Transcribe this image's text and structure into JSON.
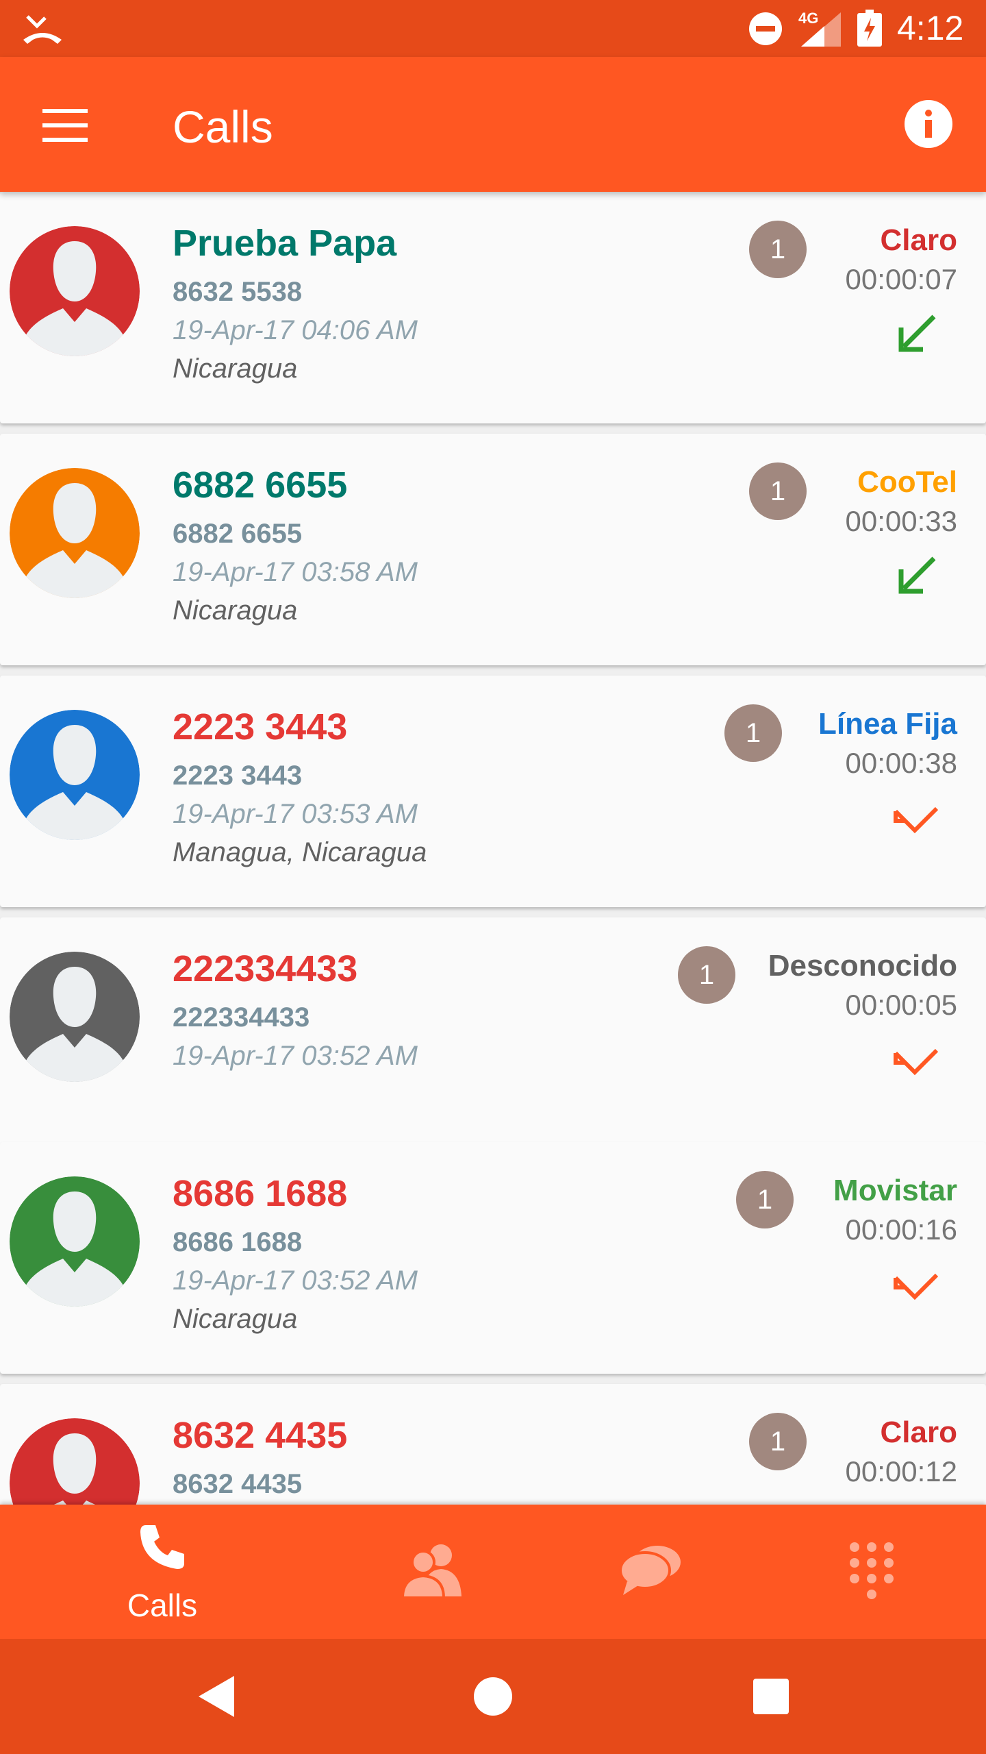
{
  "status_bar": {
    "network": "4G",
    "time": "4:12",
    "icons": [
      "missed-call-icon",
      "do-not-disturb-icon",
      "signal-icon",
      "battery-charging-icon"
    ]
  },
  "app_bar": {
    "title": "Calls",
    "icons": [
      "menu-icon",
      "info-icon"
    ]
  },
  "calls": [
    {
      "name": "Prueba Papa",
      "number": "8632 5538",
      "datetime": "19-Apr-17 04:06 AM",
      "location": "Nicaragua",
      "count": "1",
      "carrier": "Claro",
      "duration": "00:00:07",
      "direction": "incoming",
      "avatar_color": "#d32f2f",
      "name_color": "#00796b",
      "carrier_color": "#d32f2f"
    },
    {
      "name": "6882 6655",
      "number": "6882 6655",
      "datetime": "19-Apr-17 03:58 AM",
      "location": "Nicaragua",
      "count": "1",
      "carrier": "CooTel",
      "duration": "00:00:33",
      "direction": "incoming",
      "avatar_color": "#f57c00",
      "name_color": "#00796b",
      "carrier_color": "#ffa000"
    },
    {
      "name": "2223 3443",
      "number": "2223 3443",
      "datetime": "19-Apr-17 03:53 AM",
      "location": "Managua, Nicaragua",
      "count": "1",
      "carrier": "Línea Fija",
      "duration": "00:00:38",
      "direction": "missed",
      "avatar_color": "#1976d2",
      "name_color": "#e53935",
      "carrier_color": "#1976d2"
    },
    {
      "name": "222334433",
      "number": "222334433",
      "datetime": "19-Apr-17 03:52 AM",
      "location": "",
      "count": "1",
      "carrier": "Desconocido",
      "duration": "00:00:05",
      "direction": "missed",
      "avatar_color": "#616161",
      "name_color": "#e53935",
      "carrier_color": "#616161"
    },
    {
      "name": "8686 1688",
      "number": "8686 1688",
      "datetime": "19-Apr-17 03:52 AM",
      "location": "Nicaragua",
      "count": "1",
      "carrier": "Movistar",
      "duration": "00:00:16",
      "direction": "missed",
      "avatar_color": "#388e3c",
      "name_color": "#e53935",
      "carrier_color": "#43a047"
    },
    {
      "name": "8632 4435",
      "number": "8632 4435",
      "datetime": "",
      "location": "",
      "count": "1",
      "carrier": "Claro",
      "duration": "00:00:12",
      "direction": "",
      "avatar_color": "#d32f2f",
      "name_color": "#e53935",
      "carrier_color": "#d32f2f"
    }
  ],
  "bottom_nav": {
    "tabs": [
      {
        "label": "Calls",
        "icon": "phone-icon"
      },
      {
        "label": "",
        "icon": "contacts-icon"
      },
      {
        "label": "",
        "icon": "chat-icon"
      },
      {
        "label": "",
        "icon": "dialpad-icon"
      }
    ]
  },
  "system_nav": {
    "icons": [
      "back-icon",
      "home-icon",
      "recents-icon"
    ]
  },
  "colors": {
    "primary": "#ff5722",
    "primary_dark": "#e64a19",
    "badge": "#a1887f",
    "incoming": "#2e9e2e",
    "missed": "#ff5722"
  }
}
